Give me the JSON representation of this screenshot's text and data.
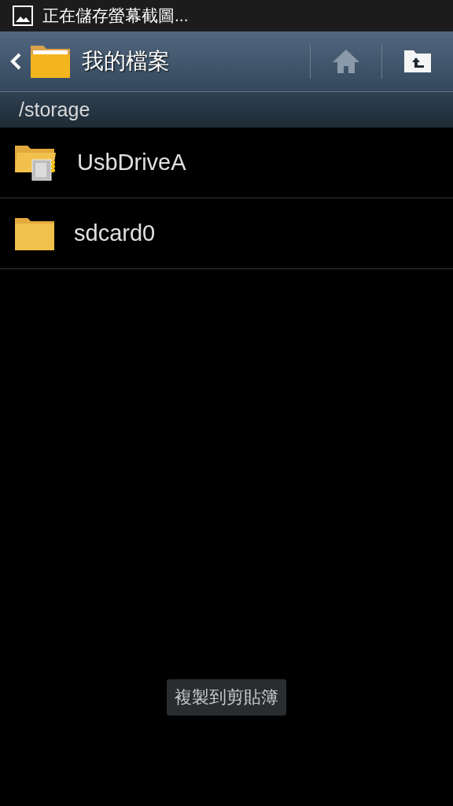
{
  "status_bar": {
    "notification": "正在儲存螢幕截圖..."
  },
  "action_bar": {
    "title": "我的檔案"
  },
  "path": "/storage",
  "items": [
    {
      "name": "UsbDriveA",
      "kind": "usb"
    },
    {
      "name": "sdcard0",
      "kind": "folder"
    }
  ],
  "toast": "複製到剪貼簿"
}
